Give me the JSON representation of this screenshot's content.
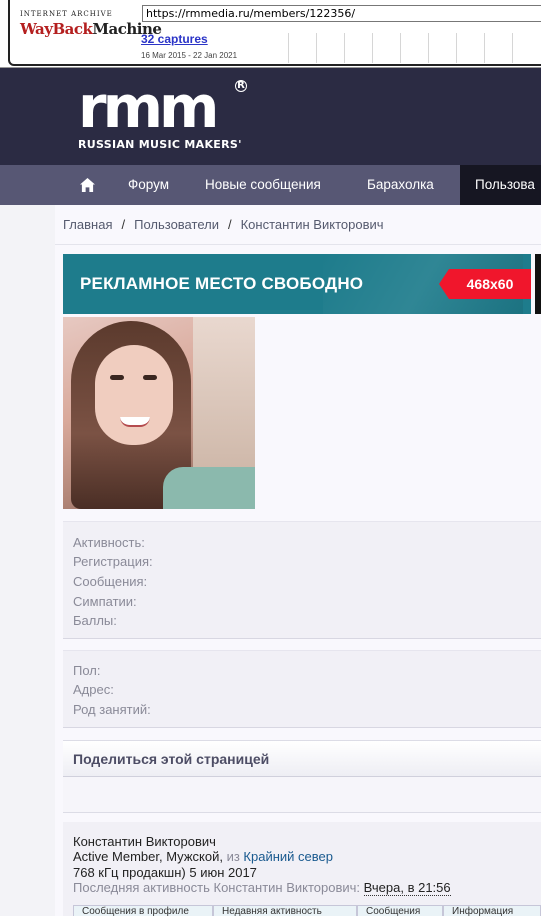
{
  "wayback": {
    "logo_top": "INTERNET ARCHIVE",
    "logo_wayback": "WayBack",
    "logo_machine": "Machine",
    "url": "https://rmmedia.ru/members/122356/",
    "captures": "32 captures",
    "dates": "16 Mar 2015 - 22 Jan 2021"
  },
  "site": {
    "logo_main": "rmm",
    "logo_reg": "R",
    "logo_sub": "RUSSIAN MUSIC MAKERS'"
  },
  "nav": {
    "items": [
      {
        "label": "Форум"
      },
      {
        "label": "Новые сообщения"
      },
      {
        "label": "Барахолка"
      },
      {
        "label": "Пользова"
      }
    ]
  },
  "breadcrumb": {
    "items": [
      "Главная",
      "Пользователи",
      "Константин Викторович"
    ],
    "separator": "/"
  },
  "ad": {
    "text": "РЕКЛАМНОЕ  МЕСТО СВОБОДНО",
    "badge": "468x60"
  },
  "stats": {
    "rows": [
      "Активность:",
      "Регистрация:",
      "Сообщения:",
      "Симпатии:",
      "Баллы:"
    ]
  },
  "details": {
    "rows": [
      "Пол:",
      "Адрес:",
      "Род занятий:"
    ]
  },
  "share": {
    "title": "Поделиться этой страницей"
  },
  "profile": {
    "name": "Константин Викторович",
    "title_prefix": "Active Member, Мужской, ",
    "from_word": "из",
    "location": "Крайний север",
    "line3": "768 кГц продакшн) 5 июн 2017",
    "last_activity_label": "Последняя активность Константин Викторович:",
    "last_activity_value": "Вчера, в 21:56"
  },
  "tabs": [
    {
      "label": "Сообщения в профиле"
    },
    {
      "label": "Недавняя активность"
    },
    {
      "label": "Сообщения"
    },
    {
      "label": "Информация"
    }
  ]
}
